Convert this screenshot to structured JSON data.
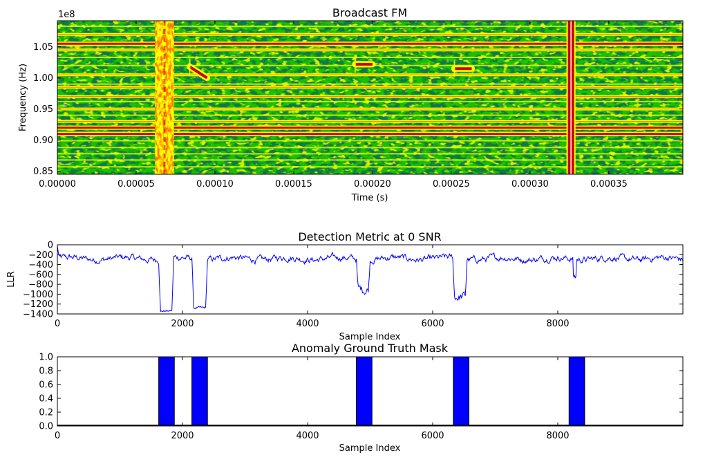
{
  "chart_data": [
    {
      "type": "heatmap",
      "title": "Broadcast FM",
      "xlabel": "Time (s)",
      "ylabel": "Frequency (Hz)",
      "y_offset_text": "1e8",
      "xlim": [
        0.0,
        0.000397
      ],
      "ylim": [
        0.845,
        1.092
      ],
      "x_ticks": [
        "0.00000",
        "0.00005",
        "0.00010",
        "0.00015",
        "0.00020",
        "0.00025",
        "0.00030",
        "0.00035"
      ],
      "x_tick_values": [
        0.0,
        5e-05,
        0.0001,
        0.00015,
        0.0002,
        0.00025,
        0.0003,
        0.00035
      ],
      "y_ticks": [
        "0.85",
        "0.90",
        "0.95",
        "1.00",
        "1.05"
      ],
      "y_tick_values": [
        0.85,
        0.9,
        0.95,
        1.0,
        1.05
      ],
      "colormap": [
        "#0033cc",
        "#00a050",
        "#22cc00",
        "#ffff00",
        "#ff6600",
        "#cc0000"
      ],
      "strong_carriers": [
        1.055,
        0.92,
        0.91
      ],
      "medium_carriers": [
        1.07,
        1.045,
        1.005,
        0.985,
        0.97,
        0.95,
        0.93
      ],
      "weak_carriers": [
        1.083,
        1.033,
        1.02,
        0.99,
        0.962,
        0.94,
        0.899,
        0.888,
        0.878,
        0.868,
        0.857
      ],
      "burst_events": [
        {
          "t_start": 6.2e-05,
          "t_end": 7.4e-05,
          "f_low": 0.845,
          "f_high": 1.092
        },
        {
          "t_start": 0.000324,
          "t_end": 0.000328,
          "f_low": 0.845,
          "f_high": 1.092
        }
      ],
      "chirp_events": [
        {
          "t_start": 8.4e-05,
          "t_end": 9.5e-05,
          "f_start": 1.018,
          "f_end": 1.0
        },
        {
          "t_start": 0.000189,
          "t_end": 0.0002,
          "f_start": 1.022,
          "f_end": 1.022
        },
        {
          "t_start": 0.000252,
          "t_end": 0.000263,
          "f_start": 1.015,
          "f_end": 1.015
        }
      ]
    },
    {
      "type": "line",
      "title": "Detection Metric at 0 SNR",
      "xlabel": "Sample Index",
      "ylabel": "LLR",
      "xlim": [
        0,
        10000
      ],
      "ylim": [
        -1400,
        0
      ],
      "x_ticks": [
        0,
        2000,
        4000,
        6000,
        8000
      ],
      "y_ticks": [
        0,
        -200,
        -400,
        -600,
        -800,
        -1000,
        -1200,
        -1400
      ],
      "color": "#0000ff",
      "baseline": -280,
      "dips": [
        {
          "start": 1620,
          "end": 1860,
          "level": -1340
        },
        {
          "start": 2150,
          "end": 2400,
          "level": -1280
        },
        {
          "start": 4780,
          "end": 5000,
          "level": -900
        },
        {
          "start": 6320,
          "end": 6550,
          "level": -1050
        },
        {
          "start": 8240,
          "end": 8300,
          "level": -650
        }
      ]
    },
    {
      "type": "bar",
      "title": "Anomaly Ground Truth Mask",
      "xlabel": "Sample Index",
      "xlim": [
        0,
        10000
      ],
      "ylim": [
        0.0,
        1.0
      ],
      "x_ticks": [
        0,
        2000,
        4000,
        6000,
        8000
      ],
      "y_ticks": [
        "0.0",
        "0.2",
        "0.4",
        "0.6",
        "0.8",
        "1.0"
      ],
      "color": "#0000ff",
      "intervals": [
        [
          1620,
          1870
        ],
        [
          2150,
          2400
        ],
        [
          4780,
          5030
        ],
        [
          6330,
          6580
        ],
        [
          8180,
          8430
        ]
      ]
    }
  ]
}
